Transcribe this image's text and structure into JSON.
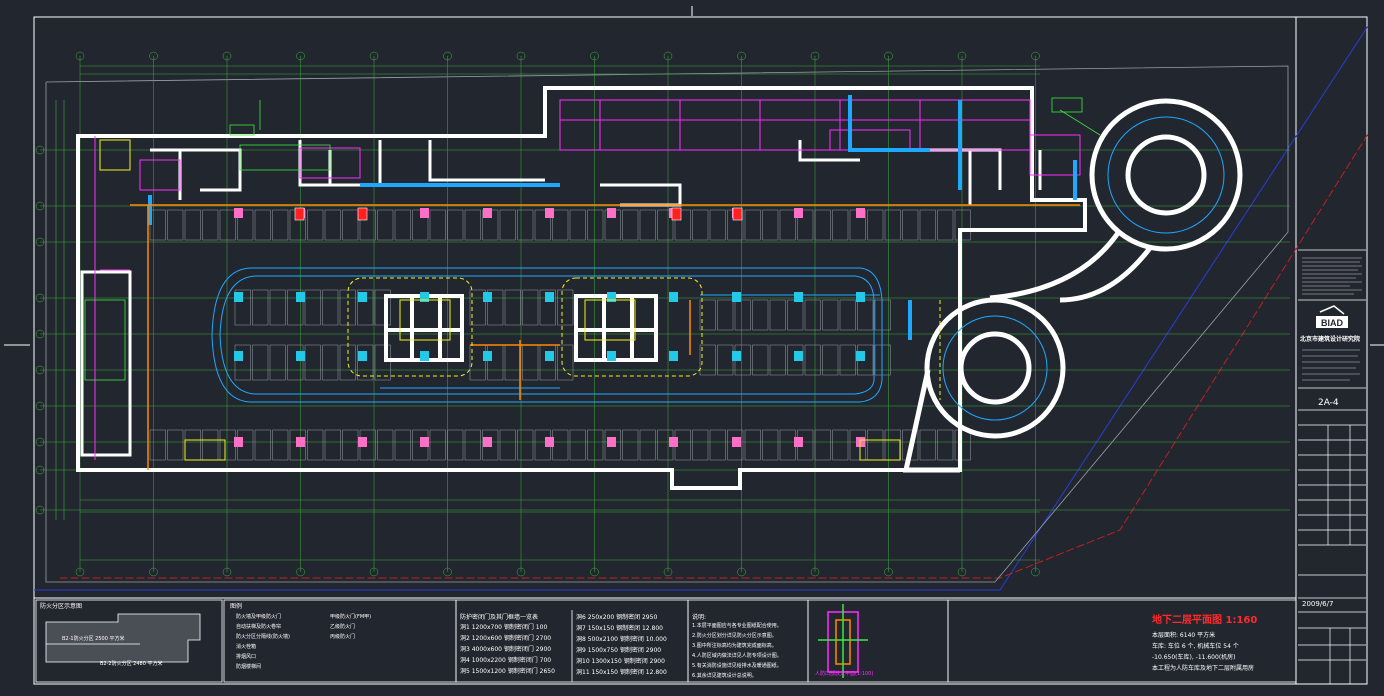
{
  "drawing": {
    "title": "地下二层平面图 1:160",
    "drawing_number": "2A-4",
    "date": "2009/6/7",
    "company_logo": "BIAD",
    "company_name": "北京市建筑设计研究院",
    "elevation_note": "-10.650(车库), -11.600(机房)",
    "building_note": "本工程为人防车库及地下二层附属用房",
    "area_note": "本层面积: 6140 平方米",
    "parking_note": "车库: 车位 6 个, 机械车位 54 个"
  },
  "legend_panels": {
    "fire_zone_title": "防火分区示意图",
    "legend_title": "图例",
    "zone_labels": [
      "B2-1防火分区 2500 平方米",
      "B2-2防火分区 2480 平方米"
    ],
    "legend_items": [
      "防火墙及甲级防火门",
      "自动扶梯及防火卷帘",
      "防火分区分隔线(防火墙)",
      "消火栓箱",
      "排烟风口",
      "防烟楼梯间"
    ],
    "legend_items_right": [
      "甲级防火门(FM甲)",
      "乙级防火门",
      "丙级防火门"
    ],
    "door_schedule_title": "防护密闭门及其门框墙一览表",
    "door_schedule_col1": [
      "洞1 1200x700 钢制密闭门 100",
      "洞2 1200x600 钢制密闭门 2700",
      "洞3 4000x600 钢制密闭门 2900",
      "洞4 1000x2200 钢制密闭门 700",
      "洞5 1500x1200 钢制密闭门 2650"
    ],
    "door_schedule_col2": [
      "洞6 250x200 钢制密闭 2950",
      "洞7 150x150 钢制密闭 12.800",
      "洞8 500x2100 钢制密闭 10.000",
      "洞9 1500x750 钢制密闭 2900",
      "洞10 1300x150 钢制密闭 2900",
      "洞11 150x150 钢制密闭 12.800"
    ],
    "notes_title": "说明:",
    "notes": [
      "1.本层平面图应与各专业图纸配合使用。",
      "2.防火分区划分详见防火分区示意图。",
      "3.图中所注标高均为建筑完成面标高。",
      "4.人防区域内做法详见人防专项设计图。",
      "5.有关消防设施详见给排水及暖通图纸。",
      "6.其余详见建筑设计总说明。"
    ],
    "section_note": "人防口部放大平面(1:100)"
  },
  "colors": {
    "background": "#22272f",
    "wall": "#ffffff",
    "grid": "#3fae3f",
    "magenta": "#ff2cff",
    "cyan": "#1ea8ff",
    "yellow": "#f2f21a",
    "orange": "#ff8800",
    "red": "#ff2020",
    "blue": "#2040ff",
    "green": "#3ee83e"
  }
}
